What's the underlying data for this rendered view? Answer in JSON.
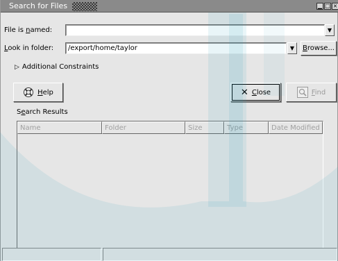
{
  "window": {
    "title": "Search for Files",
    "controls": [
      "minimize-icon",
      "maximize-icon",
      "close-icon"
    ]
  },
  "name_row": {
    "label_pre": "File is ",
    "label_mnemonic": "n",
    "label_post": "amed:",
    "value": ""
  },
  "folder_row": {
    "label_mnemonic": "L",
    "label_post": "ook in folder:",
    "value": "/export/home/taylor",
    "browse_mnemonic": "B",
    "browse_post": "rowse..."
  },
  "constraints": {
    "label": "Additional Constraints",
    "expanded": false
  },
  "buttons": {
    "help_mnemonic": "H",
    "help_post": "elp",
    "close_mnemonic": "C",
    "close_post": "lose",
    "find_mnemonic": "F",
    "find_post": "ind"
  },
  "results": {
    "title_pre": "S",
    "title_mnemonic": "e",
    "title_post": "arch Results",
    "columns": [
      "Name",
      "Folder",
      "Size",
      "Type",
      "Date Modified"
    ],
    "rows": []
  },
  "colors": {
    "window_bg": "#e6e6e6",
    "titlebar": "#8a8a8a",
    "disabled_text": "#9a9a9a"
  }
}
